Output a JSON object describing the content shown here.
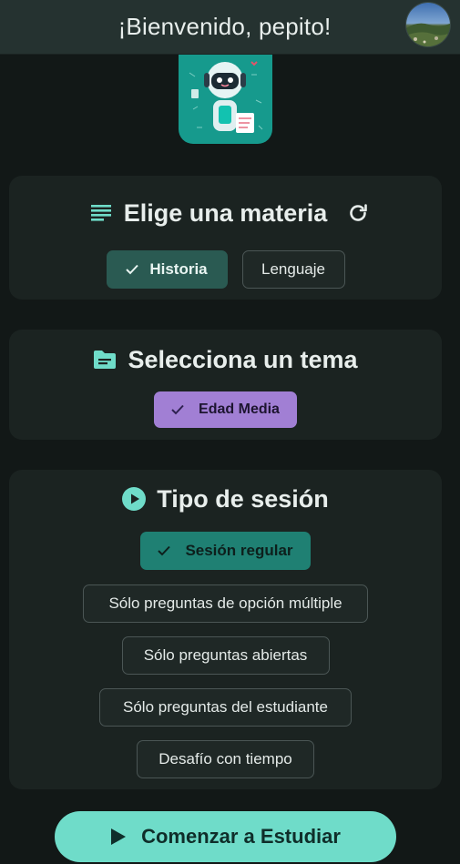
{
  "header": {
    "title": "¡Bienvenido, pepito!"
  },
  "colors": {
    "accent": "#6fdcc9",
    "selected_subject": "#2a5a52",
    "selected_topic": "#a17fd4",
    "selected_session": "#1f8073"
  },
  "subject_card": {
    "title": "Elige una materia",
    "title_icon": "list-icon",
    "action_icon": "refresh-icon",
    "chips": [
      {
        "label": "Historia",
        "selected": true
      },
      {
        "label": "Lenguaje",
        "selected": false
      }
    ]
  },
  "topic_card": {
    "title": "Selecciona un tema",
    "title_icon": "folder-icon",
    "chips": [
      {
        "label": "Edad Media",
        "selected": true
      }
    ]
  },
  "session_card": {
    "title": "Tipo de sesión",
    "title_icon": "play-circle-icon",
    "options": [
      {
        "label": "Sesión regular",
        "selected": true
      },
      {
        "label": "Sólo preguntas de opción múltiple",
        "selected": false
      },
      {
        "label": "Sólo preguntas abiertas",
        "selected": false
      },
      {
        "label": "Sólo preguntas del estudiante",
        "selected": false
      },
      {
        "label": "Desafío con tiempo",
        "selected": false
      }
    ]
  },
  "start_button": {
    "label": "Comenzar a Estudiar",
    "icon": "play-icon"
  }
}
